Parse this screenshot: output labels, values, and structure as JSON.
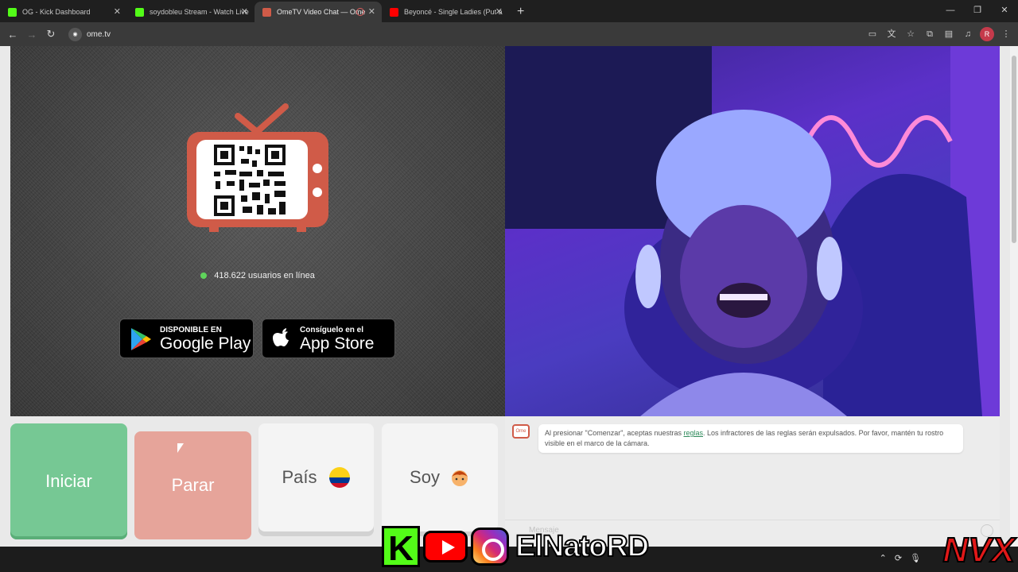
{
  "browser": {
    "tabs": [
      {
        "title": "OG - Kick Dashboard",
        "favicon_color": "#53fc18"
      },
      {
        "title": "soydobleu Stream - Watch Live",
        "favicon_color": "#53fc18"
      },
      {
        "title": "OmeTV Video Chat — Ome",
        "favicon_color": "#d05b48"
      },
      {
        "title": "Beyoncé - Single Ladies (Put a",
        "favicon_color": "#ff0000"
      }
    ],
    "address": "ome.tv",
    "profile_initial": "R"
  },
  "page": {
    "online_text": "418.622 usuarios en línea",
    "google_play": {
      "small": "DISPONIBLE EN",
      "big": "Google Play"
    },
    "app_store": {
      "small": "Consíguelo en el",
      "big": "App Store"
    },
    "buttons": {
      "start": "Iniciar",
      "stop": "Parar",
      "country": "País",
      "soy": "Soy"
    },
    "chat": {
      "notice_pre": "Al presionar \"Comenzar\", aceptas nuestras ",
      "notice_link": "reglas",
      "notice_post": ". Los infractores de las reglas serán expulsados. Por favor, mantén tu rostro visible en el marco de la cámara.",
      "message_placeholder": "Mensaje"
    }
  },
  "overlay": {
    "handle": "ElNatoRD",
    "brand": "NVX"
  },
  "colors": {
    "start_green": "#76c894",
    "stop_salmon": "#e6a49a",
    "tv_red": "#d05b48",
    "online_dot": "#5fd35b"
  }
}
